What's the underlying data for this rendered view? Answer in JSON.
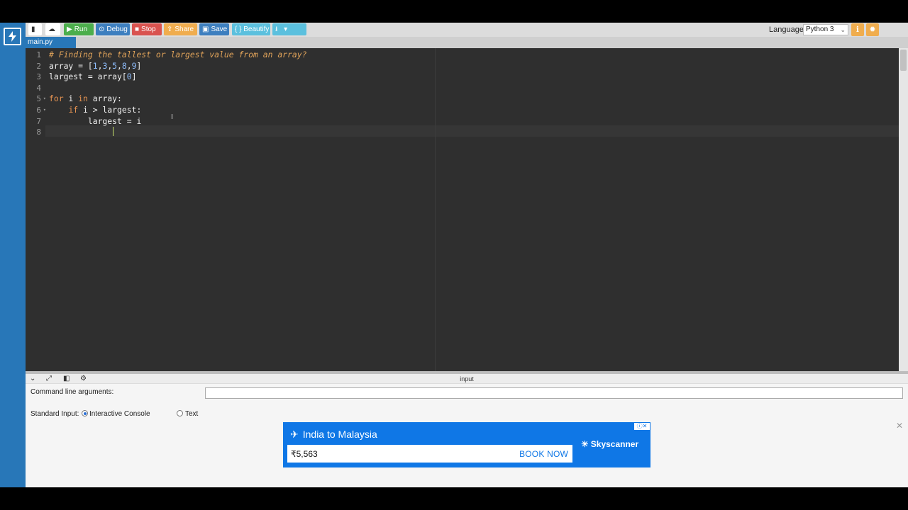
{
  "toolbar": {
    "run": "Run",
    "debug": "Debug",
    "stop": "Stop",
    "share": "Share",
    "save": "Save",
    "beautify": "{ } Beautify",
    "language_label": "Language",
    "language_value": "Python 3"
  },
  "tabs": [
    {
      "label": "main.py"
    }
  ],
  "editor": {
    "line_numbers": [
      "1",
      "2",
      "3",
      "4",
      "5",
      "6",
      "7",
      "8"
    ],
    "lines": [
      "# Finding the tallest or largest value from an array?",
      "array = [1,3,5,8,9]",
      "largest = array[0]",
      "",
      "for i in array:",
      "    if i > largest:",
      "        largest = i",
      ""
    ]
  },
  "panel": {
    "title": "input",
    "cmd_label": "Command line arguments:",
    "cmd_value": "",
    "stdin_label": "Standard Input:",
    "options": [
      "Interactive Console",
      "Text"
    ],
    "selected": "Interactive Console"
  },
  "ad": {
    "route": "India to Malaysia",
    "price": "₹5,563",
    "cta": "BOOK NOW",
    "brand": "Skyscanner"
  },
  "colors": {
    "rail": "#2877b8",
    "run": "#4cae4c",
    "debug": "#3d7fbf",
    "stop": "#d9534f",
    "share": "#f0ad4e",
    "editor_bg": "#2f2f2f",
    "ad_bg": "#0f77e6"
  },
  "icons": [
    "bolt-icon",
    "file-icon",
    "upload-icon",
    "play-icon",
    "debug-icon",
    "stop-icon",
    "share-icon",
    "save-icon",
    "download-icon",
    "info-icon",
    "settings-icon",
    "collapse-icon",
    "expand-icon",
    "layout-icon",
    "gear-icon",
    "plane-icon",
    "sun-icon",
    "close-icon"
  ]
}
